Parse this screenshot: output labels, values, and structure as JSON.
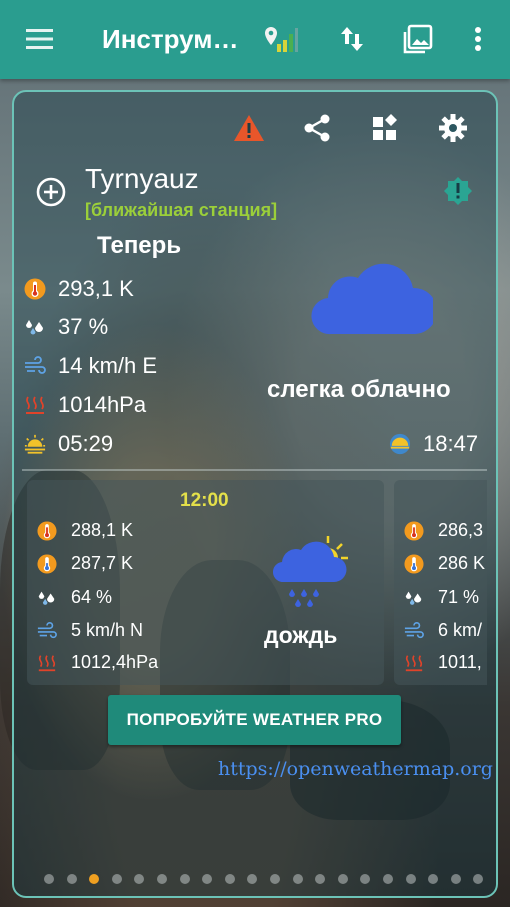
{
  "app_bar": {
    "title": "Инструм…",
    "icons": [
      "menu-icon",
      "signal-map-icon",
      "sort-arrows-icon",
      "image-icon",
      "more-vert-icon"
    ]
  },
  "card": {
    "icons": [
      "warning-icon",
      "share-icon",
      "widgets-icon",
      "settings-icon",
      "add-circle-icon",
      "station-info-icon"
    ],
    "city": "Tyrnyauz",
    "station": "[ближайшая станция]",
    "now_label": "Теперь",
    "current": {
      "temperature": "293,1 K",
      "humidity": "37 %",
      "wind": "14 km/h E",
      "pressure": "1014hPa",
      "sunrise": "05:29",
      "sunset": "18:47",
      "condition": "слегка облачно",
      "condition_icon": "cloud-icon"
    },
    "forecast": [
      {
        "time": "12:00",
        "temp_max": "288,1 K",
        "temp_min": "287,7 K",
        "humidity": "64 %",
        "wind": "5 km/h N",
        "pressure": "1012,4hPa",
        "condition": "дождь",
        "condition_icon": "rain-sun-icon"
      },
      {
        "temp_max": "286,3",
        "temp_min": "286 K",
        "humidity": "71 %",
        "wind": "6 km/",
        "pressure": "1011,"
      }
    ],
    "pro_button": "ПОПРОБУЙТЕ WEATHER PRO",
    "link": "https://openweathermap.org",
    "page_dots": {
      "count": 20,
      "active_index": 2
    }
  },
  "colors": {
    "app_bar": "#2a9d8f",
    "warning": "#e8562a",
    "station": "#9bcf3a",
    "cloud": "#3d63e0",
    "forecast_time": "#e4e04a",
    "link": "#4a8ff0",
    "active_dot": "#f0a021"
  }
}
